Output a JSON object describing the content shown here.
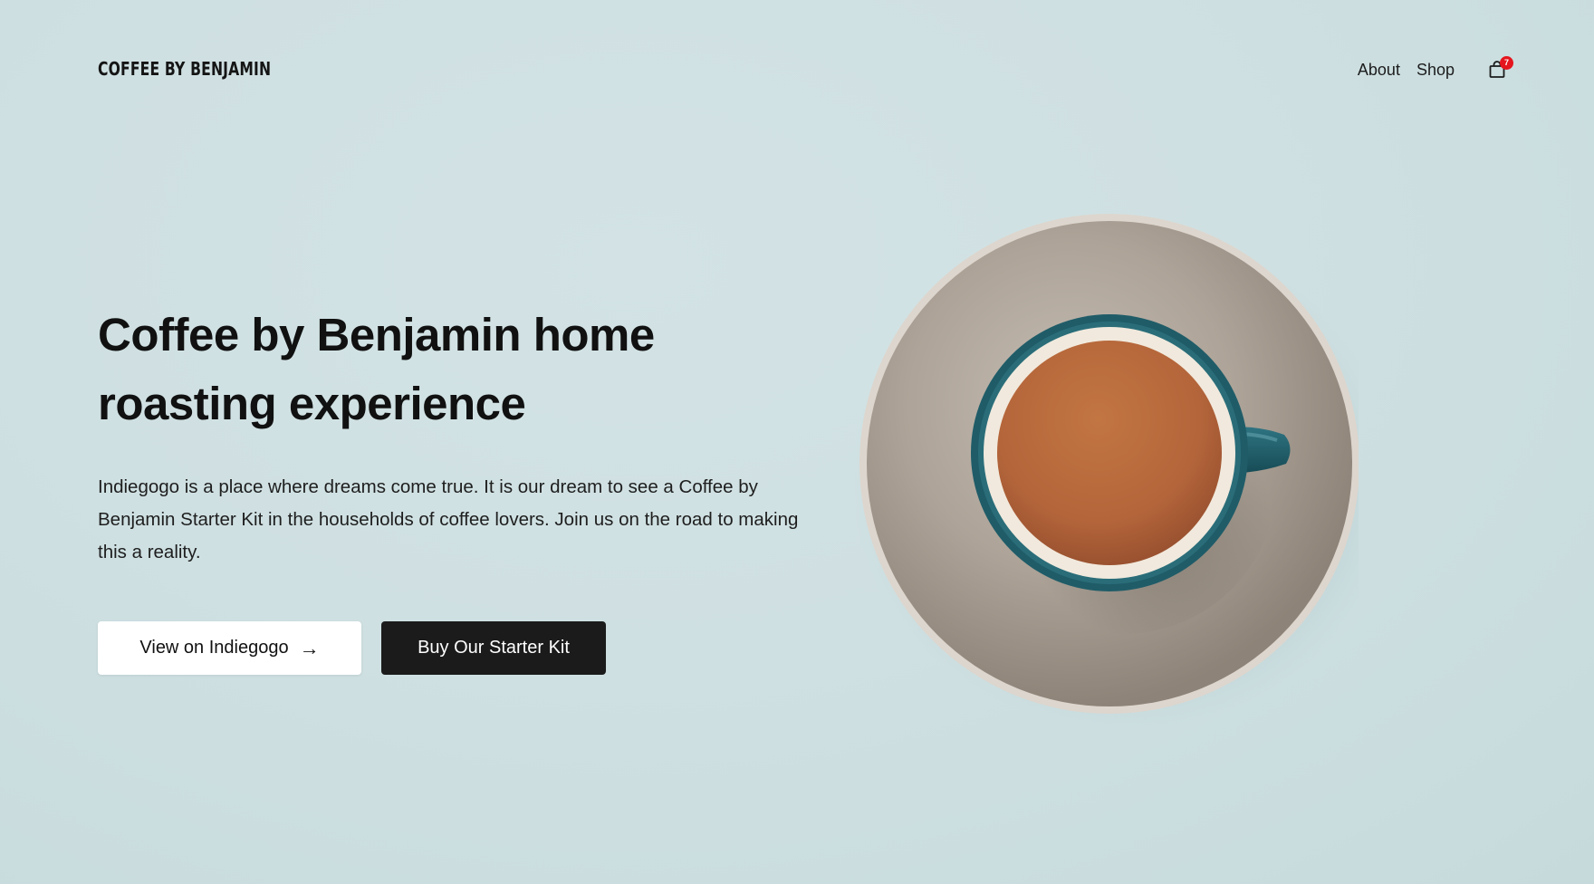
{
  "brand": {
    "logo_text": "COFFEE BY BENJAMIN"
  },
  "nav": {
    "items": [
      {
        "label": "About"
      },
      {
        "label": "Shop"
      }
    ],
    "cart_count": "7"
  },
  "hero": {
    "headline": "Coffee by Benjamin home roasting experience",
    "description": "Indiegogo is a place where dreams come true. It is our dream to see a Coffee by Benjamin Starter Kit in the households of coffee lovers. Join us on the road to making this a reality.",
    "primary_button": "View on Indiegogo",
    "secondary_button": "Buy Our Starter Kit"
  },
  "colors": {
    "background": "#cfe0e2",
    "dark_button": "#1b1b1b",
    "cart_badge": "#e5161d",
    "saucer": "#b4aba0",
    "cup": "#1e5a66",
    "coffee": "#b7683a"
  },
  "icons": {
    "cart": "shopping-bag-icon",
    "arrow": "arrow-right-icon"
  }
}
